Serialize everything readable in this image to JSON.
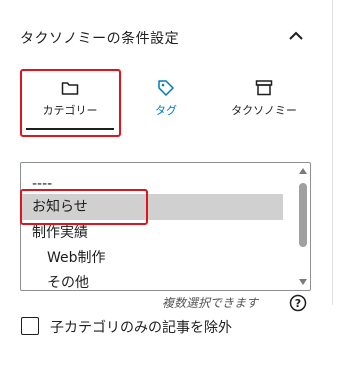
{
  "panel": {
    "title": "タクソノミーの条件設定"
  },
  "tabs": [
    {
      "label": "カテゴリー",
      "icon": "folder-icon",
      "active": true
    },
    {
      "label": "タグ",
      "icon": "tag-icon",
      "active": false
    },
    {
      "label": "タクソノミー",
      "icon": "archive-icon",
      "active": false
    }
  ],
  "listbox": {
    "options": [
      {
        "label": "----",
        "selected": false
      },
      {
        "label": "お知らせ",
        "selected": true
      },
      {
        "label": "制作実績",
        "selected": false
      },
      {
        "label": "Web制作",
        "selected": false
      },
      {
        "label": "その他",
        "selected": false
      }
    ]
  },
  "hint": "複数選択できます",
  "checkbox": {
    "label": "子カテゴリのみの記事を除外",
    "checked": false
  },
  "colors": {
    "accent": "#007cba",
    "highlight": "#e0141e",
    "selected_bg": "#d0d0d0"
  }
}
